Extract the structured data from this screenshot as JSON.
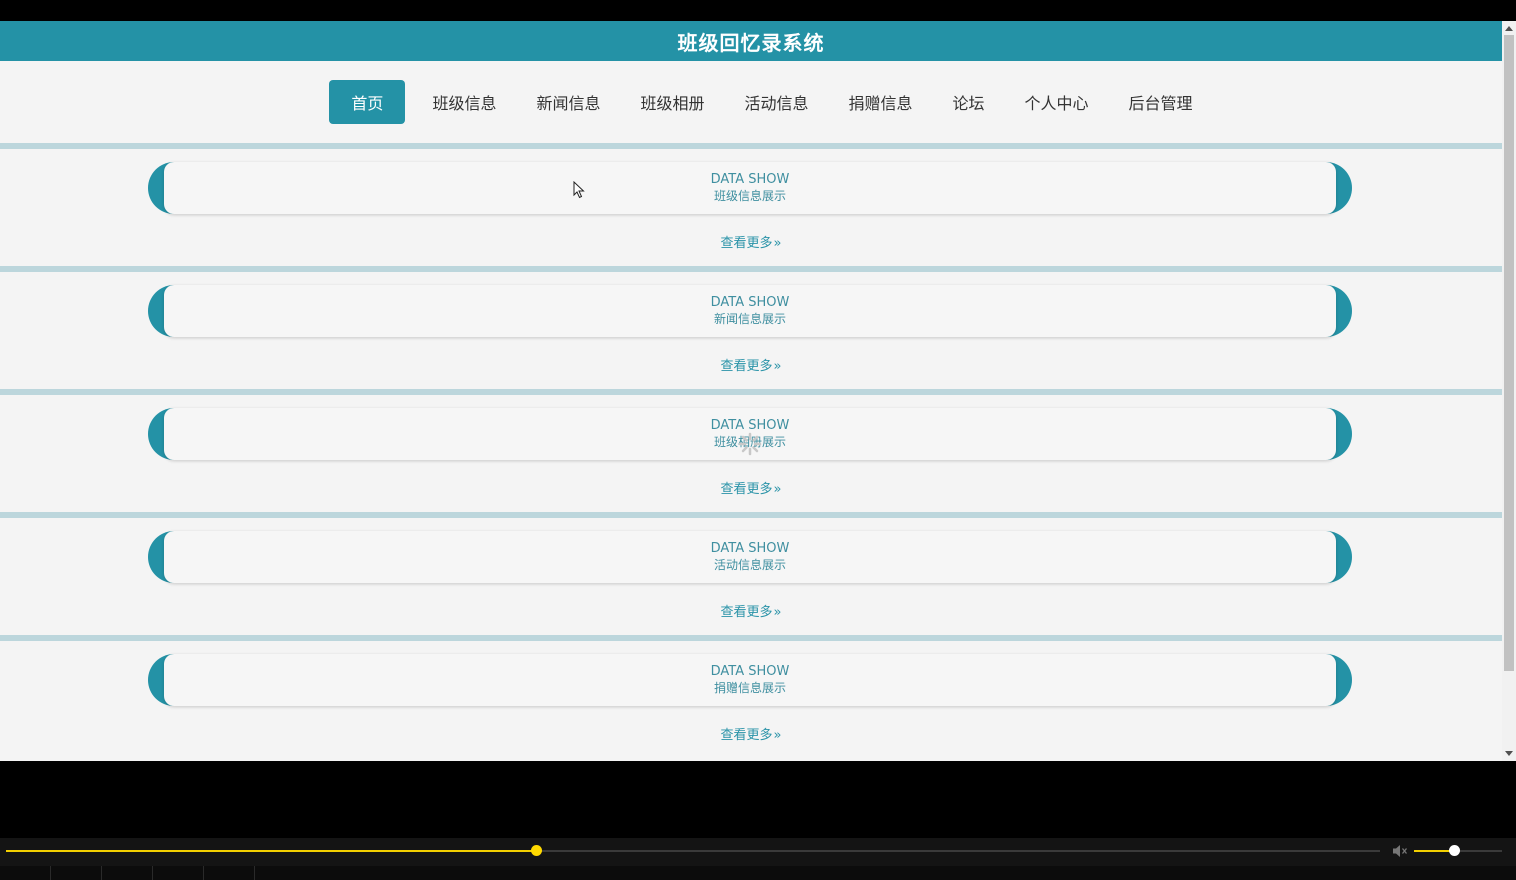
{
  "header": {
    "title": "班级回忆录系统"
  },
  "nav": {
    "items": [
      {
        "label": "首页",
        "active": true
      },
      {
        "label": "班级信息",
        "active": false
      },
      {
        "label": "新闻信息",
        "active": false
      },
      {
        "label": "班级相册",
        "active": false
      },
      {
        "label": "活动信息",
        "active": false
      },
      {
        "label": "捐赠信息",
        "active": false
      },
      {
        "label": "论坛",
        "active": false
      },
      {
        "label": "个人中心",
        "active": false
      },
      {
        "label": "后台管理",
        "active": false
      }
    ]
  },
  "sections": [
    {
      "en": "DATA SHOW",
      "cn": "班级信息展示",
      "more": "查看更多"
    },
    {
      "en": "DATA SHOW",
      "cn": "新闻信息展示",
      "more": "查看更多"
    },
    {
      "en": "DATA SHOW",
      "cn": "班级相册展示",
      "more": "查看更多"
    },
    {
      "en": "DATA SHOW",
      "cn": "活动信息展示",
      "more": "查看更多"
    },
    {
      "en": "DATA SHOW",
      "cn": "捐赠信息展示",
      "more": "查看更多"
    }
  ],
  "more_arrow": "»",
  "player": {
    "seek_progress": 0.386,
    "volume_level": 0.45
  },
  "colors": {
    "primary": "#2492a6",
    "accent_yellow": "#ffd900"
  }
}
